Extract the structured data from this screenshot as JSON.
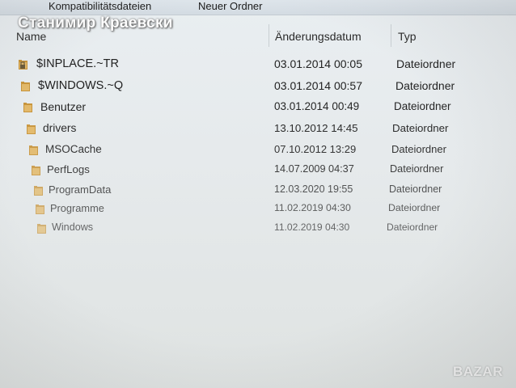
{
  "toolbar": {
    "compat_label": "Kompatibilitätsdateien",
    "new_folder_label": "Neuer Ordner"
  },
  "watermark_text": "Станимир Краевски",
  "columns": {
    "name": "Name",
    "date": "Änderungsdatum",
    "type": "Typ"
  },
  "files": [
    {
      "name": "$INPLACE.~TR",
      "date": "03.01.2014 00:05",
      "type": "Dateiordner",
      "icon": "locked-folder-icon"
    },
    {
      "name": "$WINDOWS.~Q",
      "date": "03.01.2014 00:57",
      "type": "Dateiordner",
      "icon": "folder-icon"
    },
    {
      "name": "Benutzer",
      "date": "03.01.2014 00:49",
      "type": "Dateiordner",
      "icon": "folder-icon"
    },
    {
      "name": "drivers",
      "date": "13.10.2012 14:45",
      "type": "Dateiordner",
      "icon": "folder-icon"
    },
    {
      "name": "MSOCache",
      "date": "07.10.2012 13:29",
      "type": "Dateiordner",
      "icon": "folder-icon"
    },
    {
      "name": "PerfLogs",
      "date": "14.07.2009 04:37",
      "type": "Dateiordner",
      "icon": "folder-icon"
    },
    {
      "name": "ProgramData",
      "date": "12.03.2020 19:55",
      "type": "Dateiordner",
      "icon": "folder-icon"
    },
    {
      "name": "Programme",
      "date": "11.02.2019 04:30",
      "type": "Dateiordner",
      "icon": "folder-icon"
    },
    {
      "name": "Windows",
      "date": "11.02.2019 04:30",
      "type": "Dateiordner",
      "icon": "folder-icon"
    }
  ],
  "colors": {
    "folder": "#c8943a",
    "text": "#222222"
  },
  "badge_text": "BAZAR"
}
